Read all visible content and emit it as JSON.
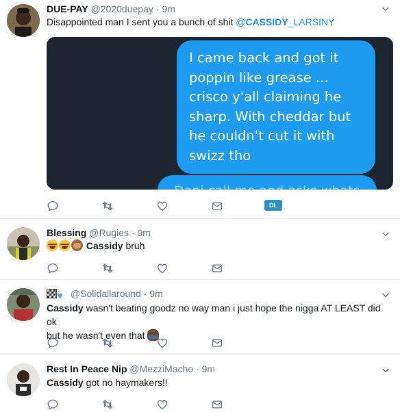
{
  "tweets": [
    {
      "name": "DUE-PAY",
      "handle": "@2020duepay",
      "sep": "·",
      "time": "9m",
      "text_before": "Disappointed man I sent you a bunch of shit ",
      "mention_at": "@",
      "mention_bold": "CASSIDY",
      "mention_rest": "_LARSINY",
      "media": {
        "bubble_text": "I came back and got it poppin like grease ... crisco  y'all claiming he sharp. With cheddar but he couldn't cut it with swizz tho",
        "bubble2_text": "Dani call me and asks whats",
        "badge": "DL"
      }
    },
    {
      "name": "Blessing",
      "handle": "@Rugies",
      "sep": "·",
      "time": "9m",
      "bold": "Cassidy",
      "rest": " bruh"
    },
    {
      "name": "",
      "handle": "@Solidallaround",
      "sep": "·",
      "time": "9m",
      "bold": "Cassidy",
      "rest_line1": " wasn't beating goodz no way man i just hope the nigga AT LEAST did ok",
      "line2": "but he wasn't even that"
    },
    {
      "name": "Rest In Peace Nip",
      "handle": "@MezziMacho",
      "sep": "·",
      "time": "9m",
      "bold": "Cassidy",
      "rest": " got no haymakers!!"
    }
  ],
  "icons": {
    "reply": "reply-icon",
    "retweet": "retweet-icon",
    "like": "heart-icon",
    "dm": "envelope-icon",
    "caret": "chevron-down-icon",
    "name_emoji_1": "checkered-flag-icon",
    "name_emoji_2": "blue-heart-icon"
  },
  "colors": {
    "link": "#1b95e0",
    "muted": "#657786",
    "bubble": "#1d9bf0",
    "media_bg": "#1c2530"
  }
}
